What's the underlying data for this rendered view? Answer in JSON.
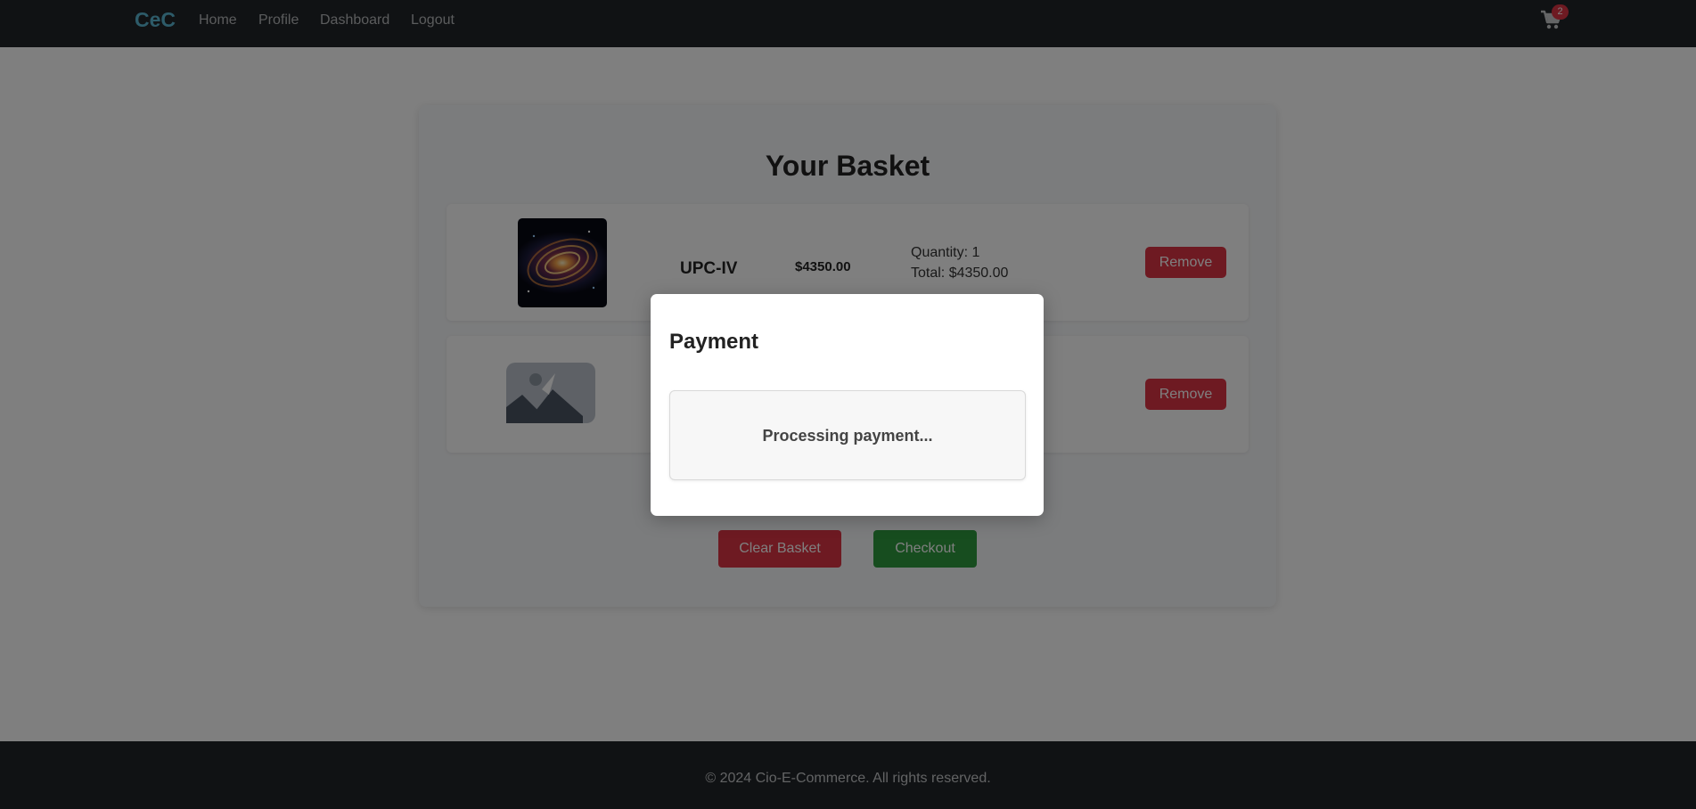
{
  "navbar": {
    "brand": "CeC",
    "links": [
      "Home",
      "Profile",
      "Dashboard",
      "Logout"
    ],
    "cart_count": "2"
  },
  "basket": {
    "title": "Your Basket",
    "items": [
      {
        "image": "galaxy-artwork",
        "name": "UPC-IV",
        "price": "$4350.00",
        "quantity": "Quantity: 1",
        "total": "Total: $4350.00",
        "remove_label": "Remove"
      },
      {
        "image": "image-placeholder-icon",
        "remove_label": "Remove"
      }
    ],
    "clear_label": "Clear Basket",
    "checkout_label": "Checkout"
  },
  "footer": {
    "text": "© 2024 Cio-E-Commerce. All rights reserved."
  },
  "modal": {
    "title": "Payment",
    "status": "Processing payment..."
  },
  "colors": {
    "navbar": "#212529",
    "brand": "#5bb7d3",
    "danger": "#dc3545",
    "success": "#2e9a3e"
  }
}
